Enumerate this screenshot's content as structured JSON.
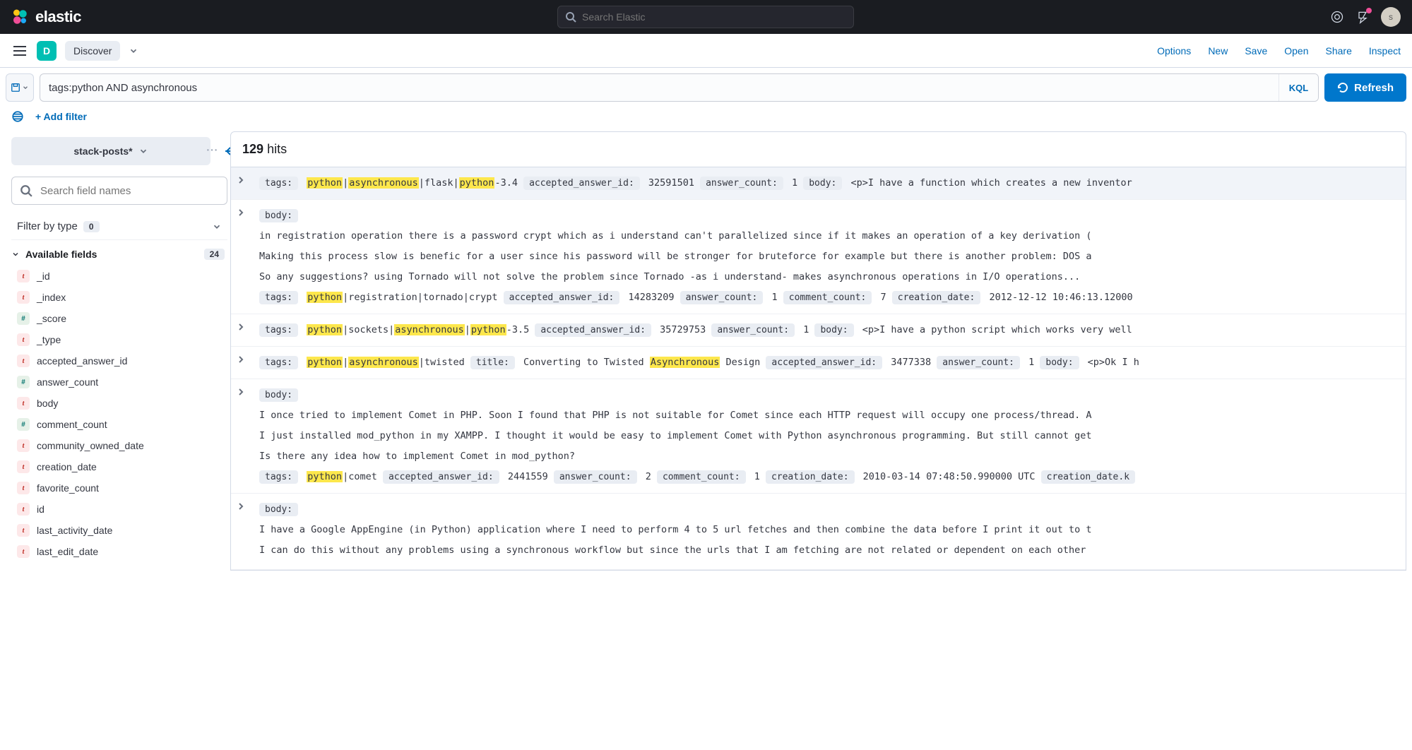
{
  "header": {
    "brand": "elastic",
    "search_placeholder": "Search Elastic",
    "avatar_initial": "s"
  },
  "app_bar": {
    "badge_letter": "D",
    "app_name": "Discover",
    "links": [
      "Options",
      "New",
      "Save",
      "Open",
      "Share",
      "Inspect"
    ]
  },
  "query": {
    "value": "tags:python AND asynchronous",
    "lang": "KQL",
    "refresh": "Refresh",
    "add_filter": "+ Add filter"
  },
  "sidebar": {
    "index_pattern": "stack-posts*",
    "field_search_placeholder": "Search field names",
    "filter_type_label": "Filter by type",
    "filter_type_count": "0",
    "available_label": "Available fields",
    "available_count": "24",
    "fields": [
      {
        "type": "t",
        "name": "_id"
      },
      {
        "type": "t",
        "name": "_index"
      },
      {
        "type": "#",
        "name": "_score"
      },
      {
        "type": "t",
        "name": "_type"
      },
      {
        "type": "t",
        "name": "accepted_answer_id"
      },
      {
        "type": "#",
        "name": "answer_count"
      },
      {
        "type": "t",
        "name": "body"
      },
      {
        "type": "#",
        "name": "comment_count"
      },
      {
        "type": "t",
        "name": "community_owned_date"
      },
      {
        "type": "t",
        "name": "creation_date"
      },
      {
        "type": "t",
        "name": "favorite_count"
      },
      {
        "type": "t",
        "name": "id"
      },
      {
        "type": "t",
        "name": "last_activity_date"
      },
      {
        "type": "t",
        "name": "last_edit_date"
      }
    ]
  },
  "results": {
    "hit_count": "129",
    "hit_label": "hits",
    "docs": [
      {
        "tags_pre": "",
        "tags_hl1": "python",
        "tags_mid1": "|",
        "tags_hl2": "asynchronous",
        "tags_mid2": "|flask|",
        "tags_hl3": "python",
        "tags_post": "-3.4",
        "aaid": "32591501",
        "answer_count": "1",
        "body_start": "<p>I have a function which creates a new inventor",
        "multi": false
      },
      {
        "body_lines": [
          "in registration operation there is a password crypt which as i understand can't parallelized since if it makes an operation of a key derivation (",
          "Making this process slow is benefic for a user since his password will be stronger for bruteforce for example but there is another problem: DOS a",
          "So any suggestions? using Tornado will not solve the problem since Tornado -as i understand- makes asynchronous operations in I/O operations..."
        ],
        "tags_pre": "",
        "tags_hl1": "python",
        "tags_mid1": "|registration|tornado|crypt",
        "aaid": "14283209",
        "answer_count": "1",
        "comment_count": "7",
        "creation_date": "2012-12-12 10:46:13.12000",
        "multi": true
      },
      {
        "tags_pre": "",
        "tags_hl1": "python",
        "tags_mid1": "|sockets|",
        "tags_hl2": "asynchronous",
        "tags_mid2": "|",
        "tags_hl3": "python",
        "tags_post": "-3.5",
        "aaid": "35729753",
        "answer_count": "1",
        "body_start": "<p>I have a python script which works very well",
        "multi": false
      },
      {
        "tags_pre": "",
        "tags_hl1": "python",
        "tags_mid1": "|",
        "tags_hl2": "asynchronous",
        "tags_mid2": "|twisted",
        "title_label": "title:",
        "title_pre": "Converting to Twisted ",
        "title_hl": "Asynchronous",
        "title_post": " Design",
        "aaid": "3477338",
        "answer_count": "1",
        "body_start": "<p>Ok I h",
        "multi": false,
        "has_title": true
      },
      {
        "body_lines": [
          "I once tried to implement Comet in PHP. Soon I found that PHP is not suitable for Comet since each HTTP request will occupy one process/thread. A",
          "I just installed mod_python in my XAMPP. I thought it would be easy to implement Comet with Python asynchronous programming. But still cannot get",
          "Is there any idea how to implement Comet in mod_python?"
        ],
        "tags_pre": "",
        "tags_hl1": "python",
        "tags_mid1": "|comet",
        "aaid": "2441559",
        "answer_count": "2",
        "comment_count": "1",
        "creation_date": "2010-03-14 07:48:50.990000 UTC",
        "creation_date_kw": "creation_date.k",
        "multi": true
      },
      {
        "body_lines": [
          "I have a Google AppEngine (in Python) application where I need to perform 4 to 5 url fetches and then combine the data before I print it out to t",
          "I can do this without any problems using a synchronous workflow but since the urls that I am fetching are not related or dependent on each other"
        ],
        "multi": true,
        "no_tags": true
      }
    ]
  }
}
